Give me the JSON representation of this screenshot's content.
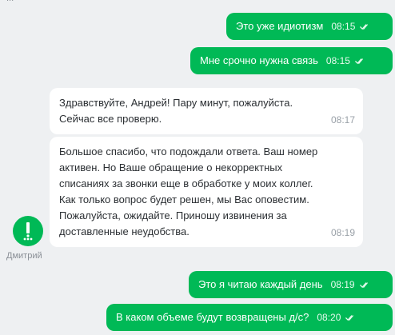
{
  "top_fragment": "...",
  "messages": [
    {
      "text": "Это уже идиотизм",
      "time": "08:15"
    },
    {
      "text": "Мне срочно нужна связь",
      "time": "08:15"
    },
    {
      "text": "Здравствуйте, Андрей! Пару минут, пожалуйста.\nСейчас все проверю.",
      "time": "08:17"
    },
    {
      "text": "Большое спасибо, что подождали ответа. Ваш номер\nактивен. Но Ваше обращение о некорректных\nсписаниях за звонки еще в обработке у моих коллег.\nКак только вопрос будет решен, мы Вас оповестим.\nПожалуйста, ожидайте. Приношу извинения за\nдоставленные неудобства.",
      "time": "08:19"
    },
    {
      "text": "Это я читаю каждый день",
      "time": "08:19"
    },
    {
      "text": "В каком объеме будут возвращены д/с?",
      "time": "08:20"
    }
  ],
  "agent": {
    "name": "Дмитрий"
  },
  "colors": {
    "accent": "#00b956",
    "background": "#eef0f2",
    "incoming_bubble": "#ffffff"
  },
  "icons": {
    "read_receipt": "double-check-icon",
    "avatar": "operator-logo-icon"
  }
}
